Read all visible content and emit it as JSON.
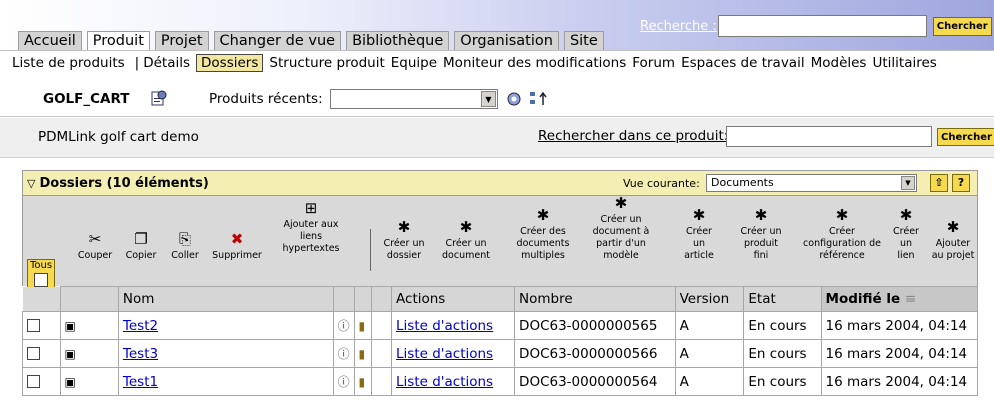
{
  "tabs": [
    "Accueil",
    "Produit",
    "Projet",
    "Changer de vue",
    "Bibliothèque",
    "Organisation",
    "Site"
  ],
  "search": {
    "label": "Recherche :",
    "button": "Chercher",
    "value": ""
  },
  "subnav": {
    "items": [
      "Liste de produits",
      "Détails",
      "Dossiers",
      "Structure produit",
      "Equipe",
      "Moniteur des modifications",
      "Forum",
      "Espaces de travail",
      "Modèles",
      "Utilitaires"
    ],
    "active": "Dossiers"
  },
  "context": {
    "product_name": "GOLF_CART",
    "recent_label": "Produits récents:",
    "recent_value": "",
    "description": "PDMLink golf cart demo",
    "product_search_label": "Rechercher dans ce produit:",
    "product_search_button": "Chercher"
  },
  "panel": {
    "title": "Dossiers (10 éléments)",
    "view_label": "Vue courante:",
    "view_value": "Documents",
    "help_label": "?"
  },
  "toolbar": {
    "select_all": "Tous",
    "actions": [
      {
        "icon": "scissors-icon",
        "glyph": "✂",
        "label": "Couper"
      },
      {
        "icon": "copy-icon",
        "glyph": "❐",
        "label": "Copier"
      },
      {
        "icon": "paste-icon",
        "glyph": "⎘",
        "label": "Coller"
      },
      {
        "icon": "delete-icon",
        "glyph": "✖",
        "label": "Supprimer"
      },
      {
        "icon": "hyperlink-icon",
        "glyph": "⊞",
        "label": "Ajouter aux\nliens\nhypertextes"
      },
      {
        "icon": "new-folder-icon",
        "glyph": "✱",
        "label": "Créer un\ndossier"
      },
      {
        "icon": "new-document-icon",
        "glyph": "✱",
        "label": "Créer un\ndocument"
      },
      {
        "icon": "new-documents-icon",
        "glyph": "✱",
        "label": "Créer des\ndocuments\nmultiples"
      },
      {
        "icon": "new-from-template-icon",
        "glyph": "✱",
        "label": "Créer un\ndocument à\npartir d'un\nmodèle"
      },
      {
        "icon": "new-article-icon",
        "glyph": "✱",
        "label": "Créer\nun\narticle"
      },
      {
        "icon": "new-end-item-icon",
        "glyph": "✱",
        "label": "Créer un\nproduit\nfini"
      },
      {
        "icon": "new-baseline-icon",
        "glyph": "✱",
        "label": "Créer\nconfiguration de\nréférence"
      },
      {
        "icon": "new-link-icon",
        "glyph": "✱",
        "label": "Créer\nun\nlien"
      },
      {
        "icon": "add-to-project-icon",
        "glyph": "✱",
        "label": "Ajouter\nau projet"
      }
    ]
  },
  "table": {
    "columns": [
      "Nom",
      "Actions",
      "Nombre",
      "Version",
      "Etat",
      "Modifié le"
    ],
    "sort_indicator": "≡",
    "rows": [
      {
        "name": "Test2",
        "actions": "Liste d'actions",
        "number": "DOC63-0000000565",
        "version": "A",
        "state": "En cours",
        "modified": "16 mars 2004, 04:14"
      },
      {
        "name": "Test3",
        "actions": "Liste d'actions",
        "number": "DOC63-0000000566",
        "version": "A",
        "state": "En cours",
        "modified": "16 mars 2004, 04:14"
      },
      {
        "name": "Test1",
        "actions": "Liste d'actions",
        "number": "DOC63-0000000564",
        "version": "A",
        "state": "En cours",
        "modified": "16 mars 2004, 04:14"
      }
    ]
  },
  "colors": {
    "accent_yellow": "#f5d94e",
    "panel_header": "#f5eeb2",
    "link": "#0000cc"
  }
}
